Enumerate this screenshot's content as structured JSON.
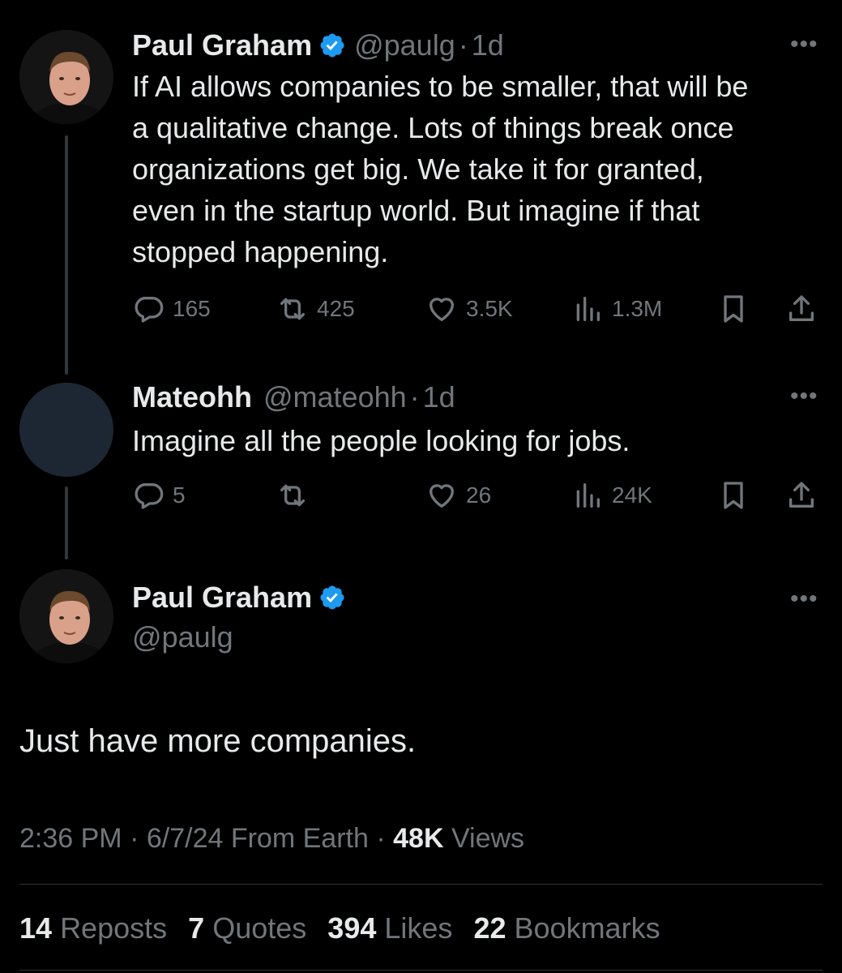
{
  "tweet1": {
    "name": "Paul Graham",
    "handle": "@paulg",
    "sep": "·",
    "time": "1d",
    "text_lines": [
      "If AI allows companies to be smaller, that will be",
      "a qualitative change. Lots of things break once",
      "organizations get big. We take it for granted,",
      "even in the startup world. But imagine if that",
      "stopped happening."
    ],
    "replies": "165",
    "reposts": "425",
    "likes": "3.5K",
    "views": "1.3M"
  },
  "tweet2": {
    "name": "Mateohh",
    "handle": "@mateohh",
    "sep": "·",
    "time": "1d",
    "text": "Imagine all the people looking for jobs.",
    "replies": "5",
    "reposts": "",
    "likes": "26",
    "views": "24K"
  },
  "main": {
    "name": "Paul Graham",
    "handle": "@paulg",
    "text": "Just have more companies.",
    "time": "2:36 PM",
    "sep1": "·",
    "date": "6/7/24",
    "source": "From Earth",
    "sep2": "·",
    "views_count": "48K",
    "views_label": "Views",
    "reposts_count": "14",
    "reposts_label": "Reposts",
    "quotes_count": "7",
    "quotes_label": "Quotes",
    "likes_count": "394",
    "likes_label": "Likes",
    "bookmarks_count": "22",
    "bookmarks_label": "Bookmarks"
  },
  "more_menu_glyph": "•••",
  "colors": {
    "background": "#000000",
    "text_primary": "#e7e9ea",
    "text_secondary": "#71767b",
    "verified_blue": "#1d9bf0",
    "divider": "#2f3336"
  },
  "icons": [
    "reply-icon",
    "repost-icon",
    "like-icon",
    "views-icon",
    "bookmark-icon",
    "share-icon",
    "verified-badge-icon",
    "more-icon"
  ]
}
